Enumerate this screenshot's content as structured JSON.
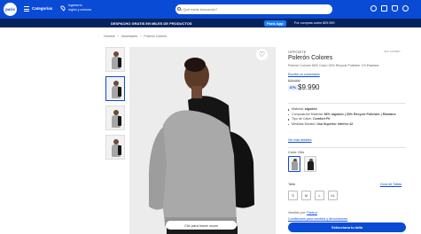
{
  "header": {
    "logo_text": "paris",
    "categories_label": "Categorías",
    "location_line1": "Ingresa tu",
    "location_line2": "región y comuna",
    "search_placeholder": "¿Qué estás buscando?",
    "brand_color": "#0a4bd6"
  },
  "promo": {
    "main_text": "DESPACHO GRATIS EN MILES DE PRODUCTOS",
    "badge": "Paris App",
    "tail": "Por compras sobre $29.990"
  },
  "breadcrumb": [
    "Hombre",
    "›",
    "Novedades",
    "›",
    "Polerón Colores"
  ],
  "gallery": {
    "zoom_hint": "Clic para hacer zoom"
  },
  "product": {
    "brand": "OPPOSITE",
    "sku": "SKU 1234567",
    "title": "Polerón Colores",
    "subtitle": "Polerón Colores 66% Coton 33% Recycle Poliester 1% Elastane",
    "rating_link": "Escribe un comentario",
    "old_price": "$29.990",
    "discount": "67%",
    "price": "$9.990",
    "specs": [
      {
        "key": "Material:",
        "value": "algodón"
      },
      {
        "key": "Composición Material:",
        "value": "66% algodón | 33% Recycle Poliester | Elastano"
      },
      {
        "key": "Tipo de Calce:",
        "value": "Comfort Fit"
      },
      {
        "key": "Medidas Modelo:",
        "value": "Usa Superior Inferior 42"
      }
    ],
    "more_details": "Ver más detalles",
    "color_label": "Color: Gris",
    "size_label": "Talla",
    "size_guide": "Guía de Tallas",
    "sizes": [
      "S",
      "M",
      "L",
      "XL"
    ],
    "seller_prefix": "Vendido por:",
    "seller_name": "Paris.cl",
    "conditions": "Condiciones para cambios y devoluciones",
    "cta": "Selecciona tu talla"
  }
}
